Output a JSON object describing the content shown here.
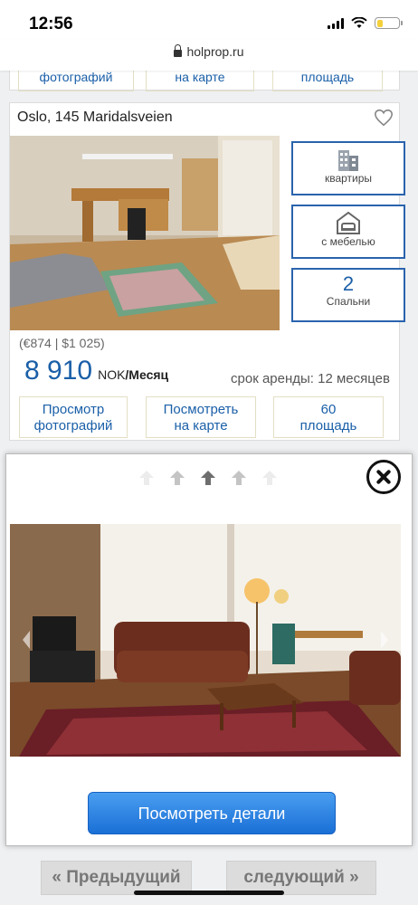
{
  "status": {
    "time": "12:56"
  },
  "browser": {
    "url": "holprop.ru"
  },
  "prev_listing": {
    "buttons": [
      "фотографий",
      "на карте",
      "площадь"
    ]
  },
  "listing": {
    "title": "Oslo, 145 Maridalsveien",
    "features": [
      {
        "icon": "apartment-building-icon",
        "label": "квартиры"
      },
      {
        "icon": "furnished-sofa-icon",
        "label": "с мебелью"
      },
      {
        "value": "2",
        "label": "Спальни"
      }
    ],
    "alt_price": "(€874 | $1 025)",
    "price": "8 910",
    "currency": "NOK",
    "period": "/Месяц",
    "lease": "срок аренды: 12 месяцев",
    "actions": [
      {
        "line1": "Просмотр",
        "line2": "фотографий"
      },
      {
        "line1": "Посмотреть",
        "line2": "на карте"
      },
      {
        "line1": "60",
        "line2": "площадь"
      }
    ]
  },
  "modal": {
    "details_button": "Посмотреть детали"
  },
  "pagination": {
    "prev": "« Предыдущий",
    "next": "следующий »"
  },
  "colors": {
    "accent": "#1a5fa8",
    "feature_border": "#2a63ad",
    "cta": "#1a6fd6"
  }
}
